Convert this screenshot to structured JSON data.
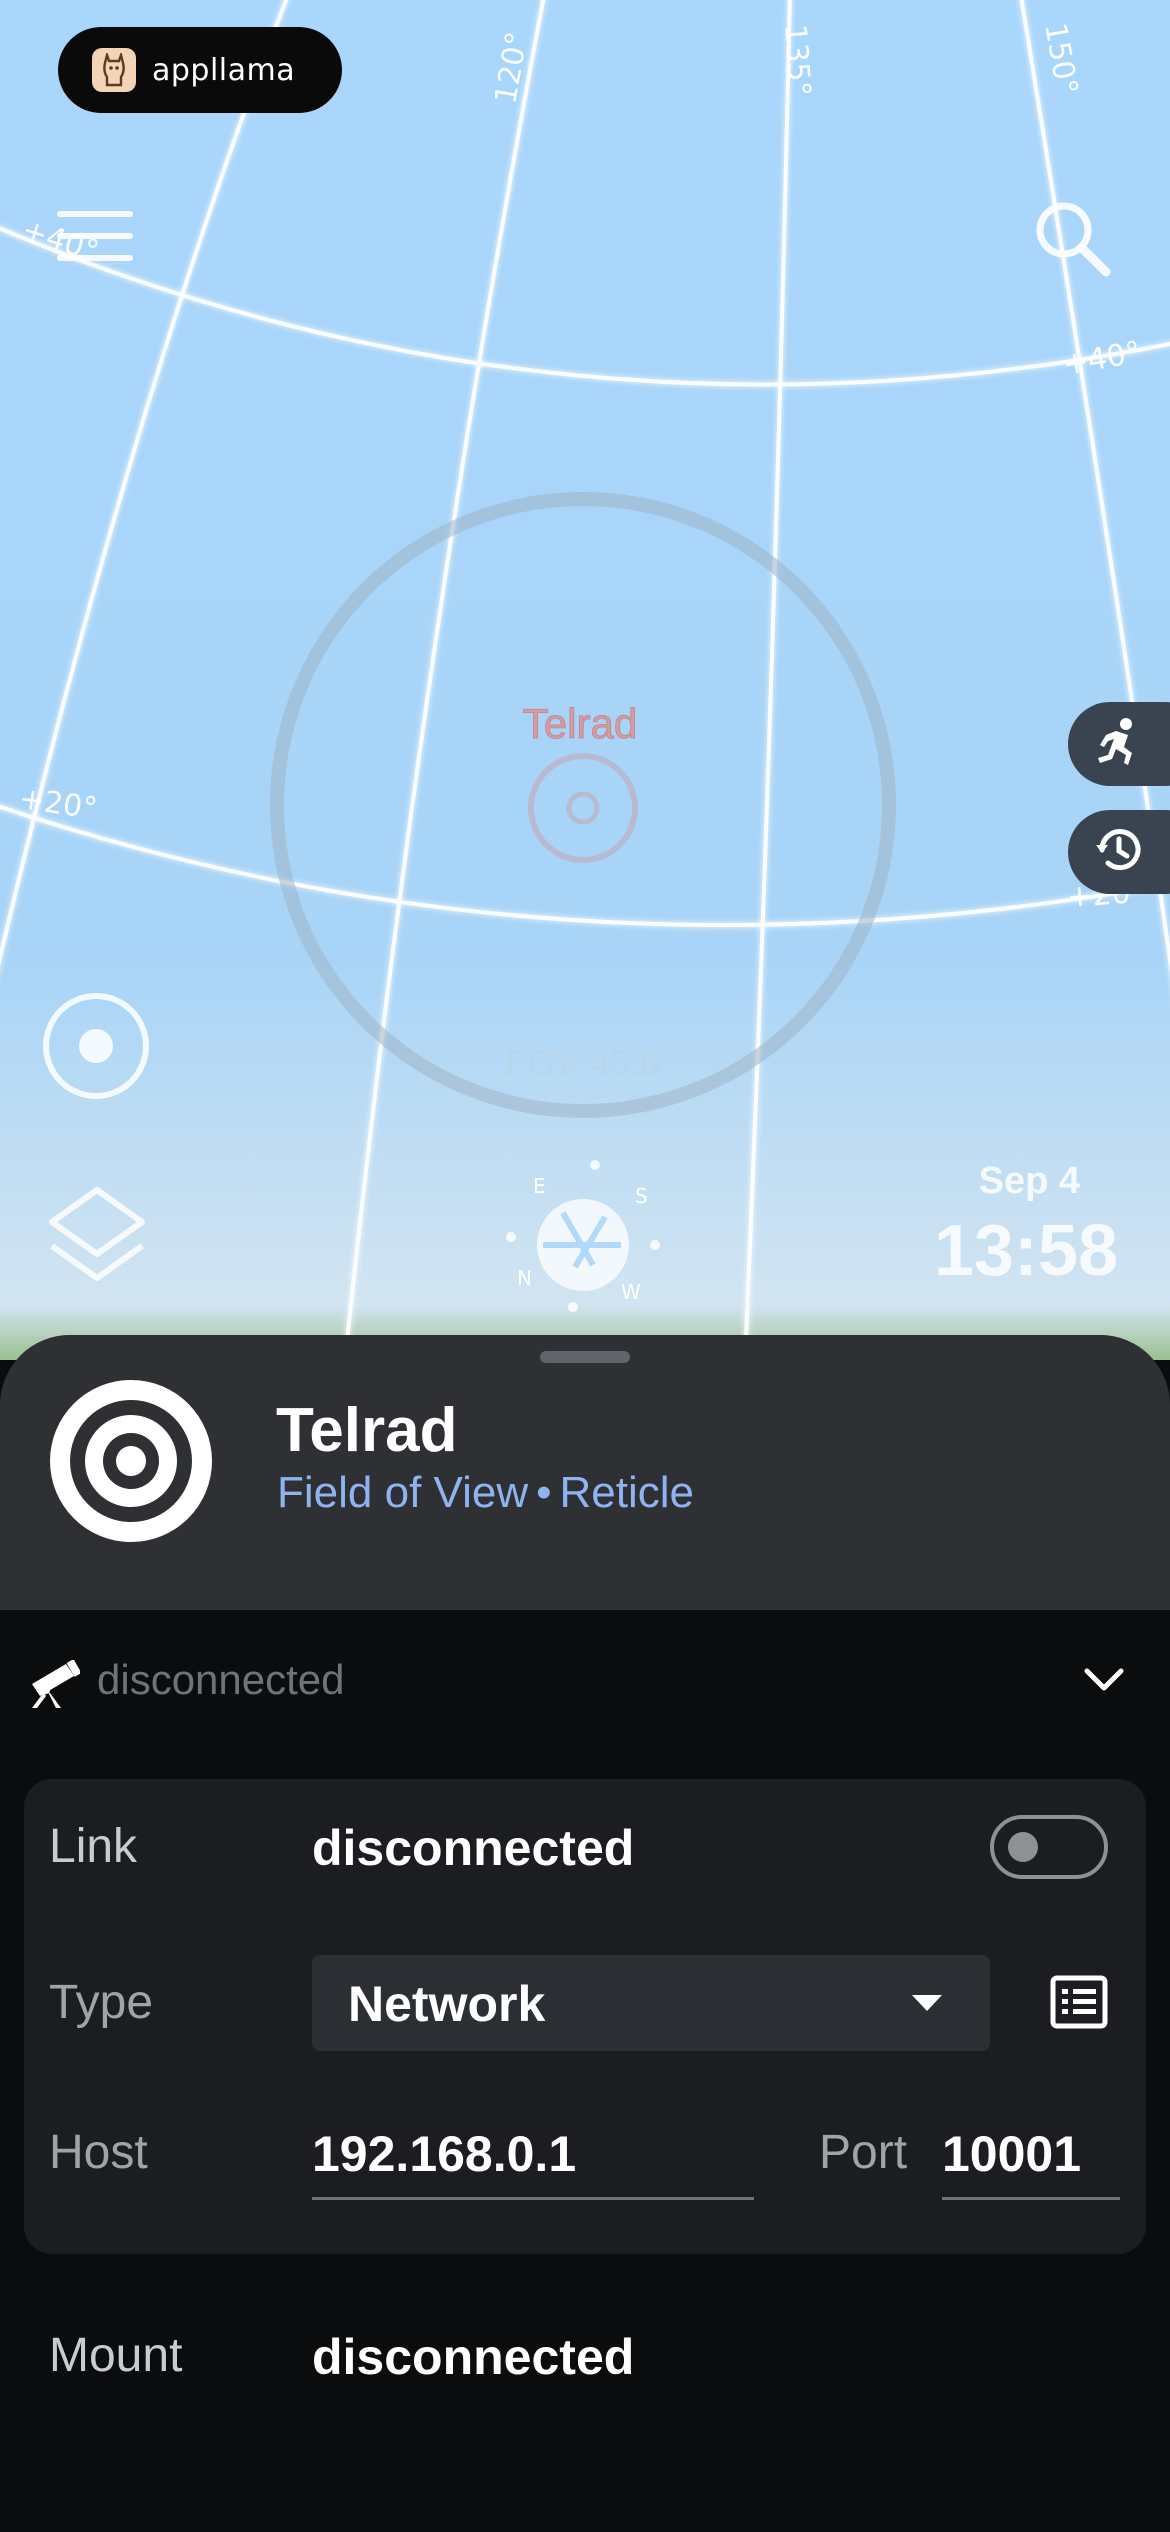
{
  "ad": {
    "brand": "appllama"
  },
  "sky": {
    "grid_labels": {
      "ra_120": "120°",
      "ra_135": "135°",
      "ra_150": "150°",
      "dec_40_left": "+40°",
      "dec_40_right": "+40°",
      "dec_20_left": "+20°",
      "dec_20_right": "+20°"
    },
    "reticle_label": "Telrad",
    "fov_label": "FOV 45.0°",
    "compass": {
      "n": "N",
      "e": "E",
      "s": "S",
      "w": "W"
    },
    "date": "Sep 4",
    "time": "13:58"
  },
  "icons": {
    "menu": "hamburger-menu-icon",
    "search": "search-icon",
    "locate": "target-icon",
    "layers": "layers-icon",
    "runner": "running-person-icon",
    "history": "history-icon"
  },
  "object": {
    "title": "Telrad",
    "category": "Field of View",
    "separator": "•",
    "subcategory": "Reticle"
  },
  "telescope": {
    "status": "disconnected",
    "link_label": "Link",
    "link_value": "disconnected",
    "type_label": "Type",
    "type_value": "Network",
    "host_label": "Host",
    "host_value": "192.168.0.1",
    "port_label": "Port",
    "port_value": "10001",
    "mount_label": "Mount",
    "mount_value": "disconnected"
  },
  "colors": {
    "sky": "#a9d6fb",
    "sheet_header": "#2e3034",
    "sheet_body": "#0b0c0e",
    "card": "#1b1d21",
    "accent_link": "#8fb3f0"
  }
}
